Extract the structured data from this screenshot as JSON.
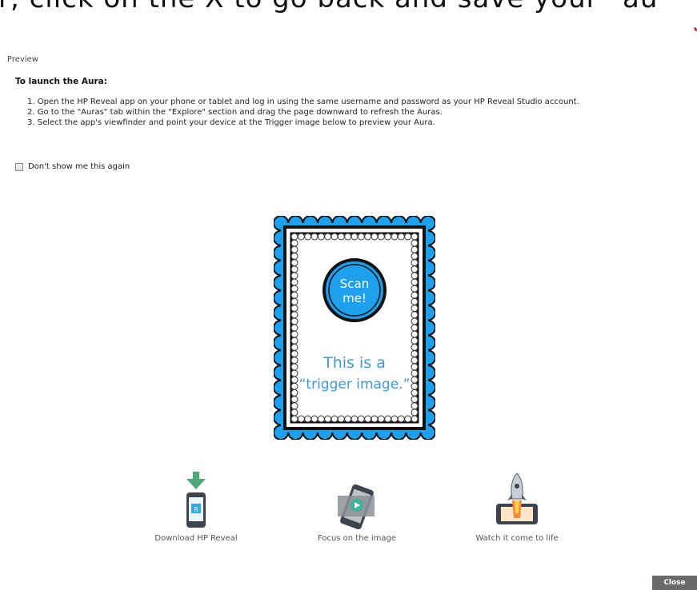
{
  "caption": {
    "text": "r, click on the X to go back and save your  “au"
  },
  "dialog": {
    "title": "Preview",
    "heading": "To launch the Aura:",
    "steps": [
      "1. Open the HP Reveal app on your phone or tablet and log in using the same username and password as your HP Reveal Studio account.",
      "2. Go to the \"Auras\" tab within the \"Explore\" section and drag the page downward to refresh the Auras.",
      "3. Select the app's viewfinder and point your device at the Trigger image below to preview your Aura."
    ],
    "dont_show_label": "Don't show me this again",
    "dont_show_checked": false,
    "trigger_image": {
      "badge_line1": "Scan",
      "badge_line2": "me!",
      "caption_line1": "This is a",
      "caption_line2": "“trigger image.”",
      "frame_color": "#1ea0ec",
      "caption_color": "#3a9ad6"
    },
    "features": [
      {
        "label": "Download HP Reveal",
        "icon": "download-phone-icon"
      },
      {
        "label": "Focus on the image",
        "icon": "phone-camera-icon"
      },
      {
        "label": "Watch it come to life",
        "icon": "rocket-phone-icon"
      }
    ],
    "close_label": "Close"
  },
  "colors": {
    "accent": "#1ea0ec",
    "close_bg": "#6a6a6a",
    "download_arrow": "#4fa878"
  }
}
